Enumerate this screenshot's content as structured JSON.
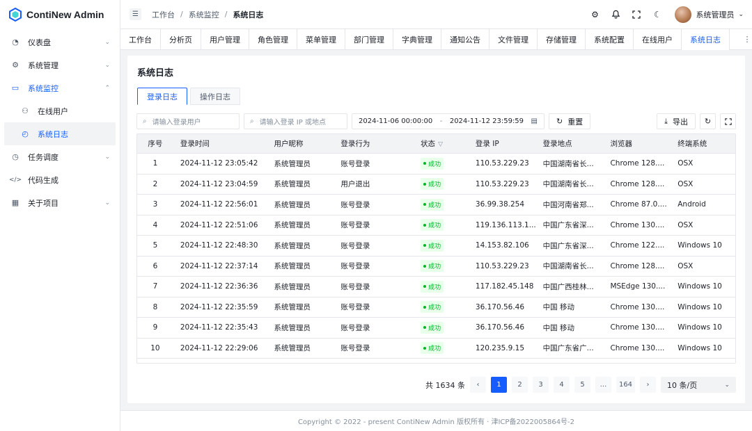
{
  "app": {
    "name": "ContiNew Admin"
  },
  "sidebar": {
    "items": [
      {
        "label": "仪表盘",
        "icon": "dashboard-icon",
        "glyph": "◔",
        "arrow": "⌄"
      },
      {
        "label": "系统管理",
        "icon": "gear-icon",
        "glyph": "⚙",
        "arrow": "⌄"
      },
      {
        "label": "系统监控",
        "icon": "monitor-icon",
        "glyph": "▭",
        "arrow": "⌃"
      },
      {
        "label": "任务调度",
        "icon": "clock-icon",
        "glyph": "◷",
        "arrow": "⌄"
      },
      {
        "label": "代码生成",
        "icon": "code-icon",
        "glyph": "</>",
        "arrow": ""
      },
      {
        "label": "关于项目",
        "icon": "apps-icon",
        "glyph": "▦",
        "arrow": "⌄"
      }
    ],
    "sub": [
      {
        "label": "在线用户",
        "icon": "user-icon",
        "glyph": "⚇"
      },
      {
        "label": "系统日志",
        "icon": "history-icon",
        "glyph": "◴"
      }
    ]
  },
  "header": {
    "breadcrumb": [
      "工作台",
      "系统监控",
      "系统日志"
    ],
    "user": "系统管理员"
  },
  "tabs": [
    "工作台",
    "分析页",
    "用户管理",
    "角色管理",
    "菜单管理",
    "部门管理",
    "字典管理",
    "通知公告",
    "文件管理",
    "存储管理",
    "系统配置",
    "在线用户",
    "系统日志"
  ],
  "page": {
    "title": "系统日志",
    "sub_tabs": [
      "登录日志",
      "操作日志"
    ],
    "search_user_placeholder": "请输入登录用户",
    "search_ip_placeholder": "请输入登录 IP 或地点",
    "range_start": "2024-11-06 00:00:00",
    "range_sep": "-",
    "range_end": "2024-11-12 23:59:59",
    "reset_label": "重置",
    "export_label": "导出"
  },
  "table": {
    "columns": [
      "序号",
      "登录时间",
      "用户昵称",
      "登录行为",
      "状态",
      "登录 IP",
      "登录地点",
      "浏览器",
      "终端系统"
    ],
    "rows": [
      [
        "1",
        "2024-11-12 23:05:42",
        "系统管理员",
        "账号登录",
        "成功",
        "110.53.229.23",
        "中国湖南省长...",
        "Chrome 128....",
        "OSX"
      ],
      [
        "2",
        "2024-11-12 23:04:59",
        "系统管理员",
        "用户退出",
        "成功",
        "110.53.229.23",
        "中国湖南省长...",
        "Chrome 128....",
        "OSX"
      ],
      [
        "3",
        "2024-11-12 22:56:01",
        "系统管理员",
        "账号登录",
        "成功",
        "36.99.38.254",
        "中国河南省郑...",
        "Chrome 87.0....",
        "Android"
      ],
      [
        "4",
        "2024-11-12 22:51:06",
        "系统管理员",
        "账号登录",
        "成功",
        "119.136.113.1...",
        "中国广东省深...",
        "Chrome 130....",
        "OSX"
      ],
      [
        "5",
        "2024-11-12 22:48:30",
        "系统管理员",
        "账号登录",
        "成功",
        "14.153.82.106",
        "中国广东省深...",
        "Chrome 122....",
        "Windows 10"
      ],
      [
        "6",
        "2024-11-12 22:37:14",
        "系统管理员",
        "账号登录",
        "成功",
        "110.53.229.23",
        "中国湖南省长...",
        "Chrome 128....",
        "OSX"
      ],
      [
        "7",
        "2024-11-12 22:36:36",
        "系统管理员",
        "账号登录",
        "成功",
        "117.182.45.148",
        "中国广西桂林...",
        "MSEdge 130....",
        "Windows 10"
      ],
      [
        "8",
        "2024-11-12 22:35:59",
        "系统管理员",
        "账号登录",
        "成功",
        "36.170.56.46",
        "中国 移动",
        "Chrome 130....",
        "Windows 10"
      ],
      [
        "9",
        "2024-11-12 22:35:43",
        "系统管理员",
        "账号登录",
        "成功",
        "36.170.56.46",
        "中国 移动",
        "Chrome 130....",
        "Windows 10"
      ],
      [
        "10",
        "2024-11-12 22:29:06",
        "系统管理员",
        "账号登录",
        "成功",
        "120.235.9.15",
        "中国广东省广...",
        "Chrome 130....",
        "Windows 10"
      ]
    ]
  },
  "pagination": {
    "total": "共 1634 条",
    "current": "1",
    "pages": [
      "2",
      "3",
      "4",
      "5",
      "...",
      "164"
    ],
    "size": "10 条/页"
  },
  "footer": "Copyright © 2022 - present ContiNew Admin 版权所有 · 津ICP备2022005864号-2",
  "colors": {
    "primary": "#165dff",
    "success": "#00b42a"
  }
}
